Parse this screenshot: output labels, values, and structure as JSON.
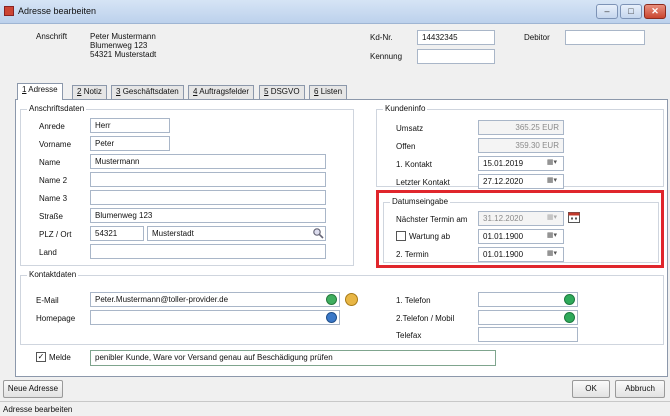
{
  "window": {
    "title": "Adresse bearbeiten",
    "min": "–",
    "max": "□",
    "close": "✕"
  },
  "header": {
    "anschrift_label": "Anschrift",
    "anschrift_lines": [
      "Peter Mustermann",
      "Blumenweg 123",
      "54321 Musterstadt"
    ],
    "kdnr_label": "Kd-Nr.",
    "kdnr_value": "14432345",
    "debitor_label": "Debitor",
    "debitor_value": "",
    "kennung_label": "Kennung",
    "kennung_value": ""
  },
  "tabs": [
    {
      "num": "1",
      "label": "Adresse"
    },
    {
      "num": "2",
      "label": "Notiz"
    },
    {
      "num": "3",
      "label": "Geschäftsdaten"
    },
    {
      "num": "4",
      "label": "Auftragsfelder"
    },
    {
      "num": "5",
      "label": "DSGVO"
    },
    {
      "num": "6",
      "label": "Listen"
    }
  ],
  "anschrift": {
    "title": "Anschriftsdaten",
    "anrede_label": "Anrede",
    "anrede": "Herr",
    "vorname_label": "Vorname",
    "vorname": "Peter",
    "name_label": "Name",
    "name": "Mustermann",
    "name2_label": "Name 2",
    "name2": "",
    "name3_label": "Name 3",
    "name3": "",
    "strasse_label": "Straße",
    "strasse": "Blumenweg 123",
    "plzort_label": "PLZ / Ort",
    "plz": "54321",
    "ort": "Musterstadt",
    "land_label": "Land",
    "land": ""
  },
  "kundeninfo": {
    "title": "Kundeninfo",
    "umsatz_label": "Umsatz",
    "umsatz": "365.25 EUR",
    "offen_label": "Offen",
    "offen": "359.30 EUR",
    "kontakt1_label": "1. Kontakt",
    "kontakt1": "15.01.2019",
    "letzter_label": "Letzter Kontakt",
    "letzter": "27.12.2020"
  },
  "datumseingabe": {
    "title": "Datumseingabe",
    "naechster_label": "Nächster Termin am",
    "naechster": "31.12.2020",
    "wartung_label": "Wartung ab",
    "wartung": "01.01.1900",
    "termin2_label": "2. Termin",
    "termin2": "01.01.1900"
  },
  "kontakt": {
    "title": "Kontaktdaten",
    "email_label": "E-Mail",
    "email": "Peter.Mustermann@toller-provider.de",
    "homepage_label": "Homepage",
    "homepage": "",
    "telefon1_label": "1. Telefon",
    "telefon1": "",
    "telefon2_label": "2.Telefon / Mobil",
    "telefon2": "",
    "telefax_label": "Telefax",
    "telefax": ""
  },
  "melde": {
    "label": "Melde",
    "checked": "✓",
    "value": "penibler Kunde, Ware vor Versand genau auf Beschädigung prüfen"
  },
  "buttons": {
    "neue_adresse": "Neue Adresse",
    "ok": "OK",
    "abbruch": "Abbruch"
  },
  "status": "Adresse bearbeiten",
  "colors": {
    "highlight_border": "#e0262c",
    "phone_icon": "#2faa5a",
    "link_icon": "#3a78c8"
  }
}
